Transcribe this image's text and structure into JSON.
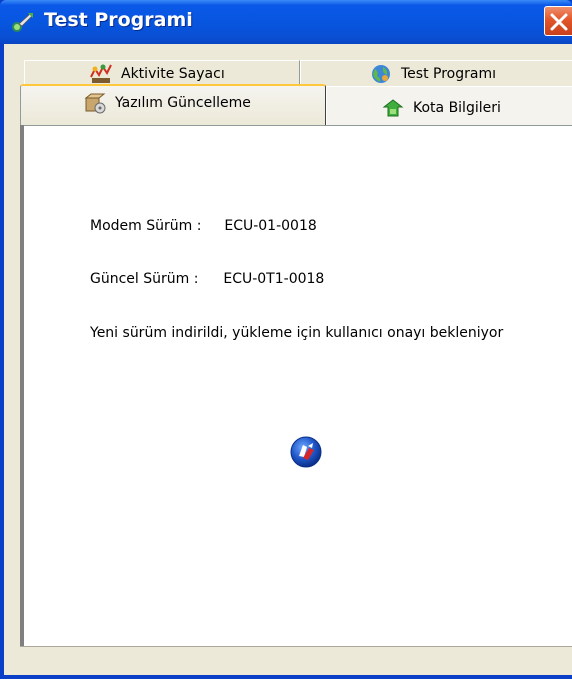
{
  "window": {
    "title": "Test Programi",
    "icon": "app-icon",
    "close_icon": "close-icon"
  },
  "tabs": {
    "row_back": [
      {
        "label": "Aktivite Sayacı",
        "icon": "activity-counter-icon"
      },
      {
        "label": "Test Programı",
        "icon": "globe-icon"
      }
    ],
    "row_front": [
      {
        "label": "Yazılım Güncelleme",
        "icon": "software-update-icon",
        "active": true
      },
      {
        "label": "Kota Bilgileri",
        "icon": "quota-icon",
        "active": false
      }
    ]
  },
  "content": {
    "modem_label": "Modem Sürüm :",
    "modem_value": "ECU-01-0018",
    "current_label": "Güncel Sürüm :",
    "current_value": "ECU-0T1-0018",
    "status_message": "Yeni sürüm indirildi, yükleme için kullanıcı onayı bekleniyor",
    "action_icon": "install-update-icon"
  },
  "colors": {
    "titlebar": "#0756e0",
    "active_tab_accent": "#ffc73c",
    "close_button": "#e2562a"
  }
}
